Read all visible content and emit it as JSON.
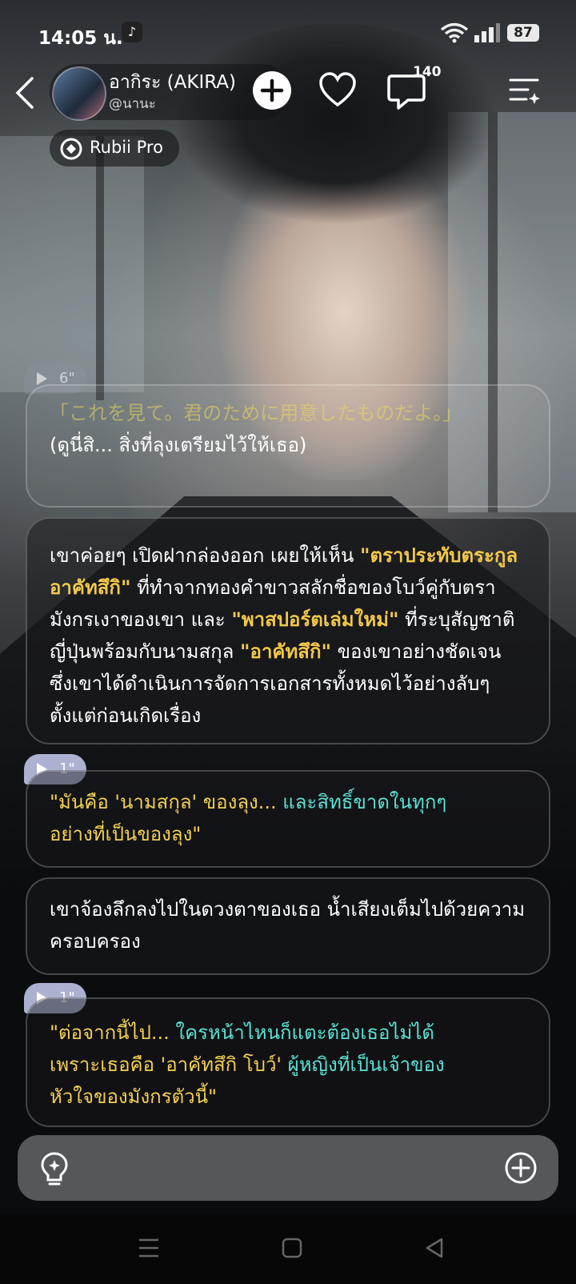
{
  "status_bar": {
    "time": "14:05 น.",
    "battery": "87"
  },
  "header": {
    "character_name": "อากิระ (AKIRA)",
    "creator_handle": "@นานะ",
    "comment_count": "140",
    "badge_label": "Rubii Pro"
  },
  "messages": [
    {
      "duration": "6\"",
      "jp_text": "「これを見て。君のために用意したものだよ。」",
      "thai_text": "(ดูนี่สิ... สิ่งที่ลุงเตรียมไว้ให้เธอ)"
    },
    {
      "p1": "เขาค่อยๆ เปิดฝากล่องออก เผยให้เห็น ",
      "h1": "\"ตราประทับตระกูลอาคัทสึกิ\"",
      "p2": " ที่ทำจากทองคำขาวสลักชื่อของโบว์คู่กับตรามังกรเงาของเขา และ ",
      "h2": "\"พาสปอร์ตเล่มใหม่\"",
      "p3": " ที่ระบุสัญชาติญี่ปุ่นพร้อมกับนามสกุล ",
      "h3": "\"อาคัทสึกิ\"",
      "p4": " ของเขาอย่างชัดเจน ซึ่งเขาได้ดำเนินการจัดการเอกสารทั้งหมดไว้อย่างลับๆ ตั้งแต่ก่อนเกิดเรื่อง"
    },
    {
      "duration": "1\"",
      "a": "\"มันคือ 'นามสกุล' ของลุง... ",
      "b": "และสิทธิ์ขาดในทุกๆ",
      "c": "อย่างที่เป็นของลุง\""
    },
    {
      "text": "เขาจ้องลึกลงไปในดวงตาของเธอ น้ำเสียงเต็มไปด้วยความครอบครอง"
    },
    {
      "duration": "1\"",
      "a": "\"ต่อจากนี้ไป... ",
      "b": "ใครหน้าไหนก็แตะต้องเธอไม่ได้",
      "c": "เพราะเธอคือ 'อาคัทสึกิ โบว์' ",
      "d": "ผู้หญิงที่เป็นเจ้าของ",
      "e": "หัวใจของมังกรตัวนี้\""
    }
  ],
  "colors": {
    "highlight": "#f3c84a",
    "dialog_warm": "#f2cf52",
    "dialog_cool": "#5ce0d2",
    "voice_tag": "#bec3e6"
  },
  "icons": {
    "back": "chevron-left-icon",
    "follow": "plus-circle-icon",
    "like": "heart-icon",
    "comments": "chat-bubble-icon",
    "menu": "list-sparkle-icon",
    "hint": "lightbulb-icon",
    "add": "plus-circle-outline-icon"
  }
}
